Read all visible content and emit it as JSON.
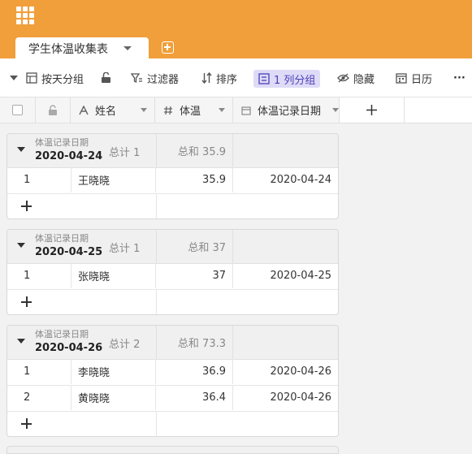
{
  "tab": {
    "label": "学生体温收集表"
  },
  "toolbar": {
    "group_by_day": "按天分组",
    "filter": "过滤器",
    "sort": "排序",
    "grouping": "1 列分组",
    "hide": "隐藏",
    "calendar": "日历",
    "more": "···"
  },
  "columns": {
    "name": "姓名",
    "temp": "体温",
    "date": "体温记录日期"
  },
  "groups": [
    {
      "field": "体温记录日期",
      "value": "2020-04-24",
      "count": "总计 1",
      "sum": "总和 35.9",
      "rows": [
        {
          "idx": "1",
          "name": "王晓晓",
          "temp": "35.9",
          "date": "2020-04-24"
        }
      ]
    },
    {
      "field": "体温记录日期",
      "value": "2020-04-25",
      "count": "总计 1",
      "sum": "总和 37",
      "rows": [
        {
          "idx": "1",
          "name": "张晓晓",
          "temp": "37",
          "date": "2020-04-25"
        }
      ]
    },
    {
      "field": "体温记录日期",
      "value": "2020-04-26",
      "count": "总计 2",
      "sum": "总和 73.3",
      "rows": [
        {
          "idx": "1",
          "name": "李晓晓",
          "temp": "36.9",
          "date": "2020-04-26"
        },
        {
          "idx": "2",
          "name": "黄晓晓",
          "temp": "36.4",
          "date": "2020-04-26"
        }
      ]
    }
  ]
}
